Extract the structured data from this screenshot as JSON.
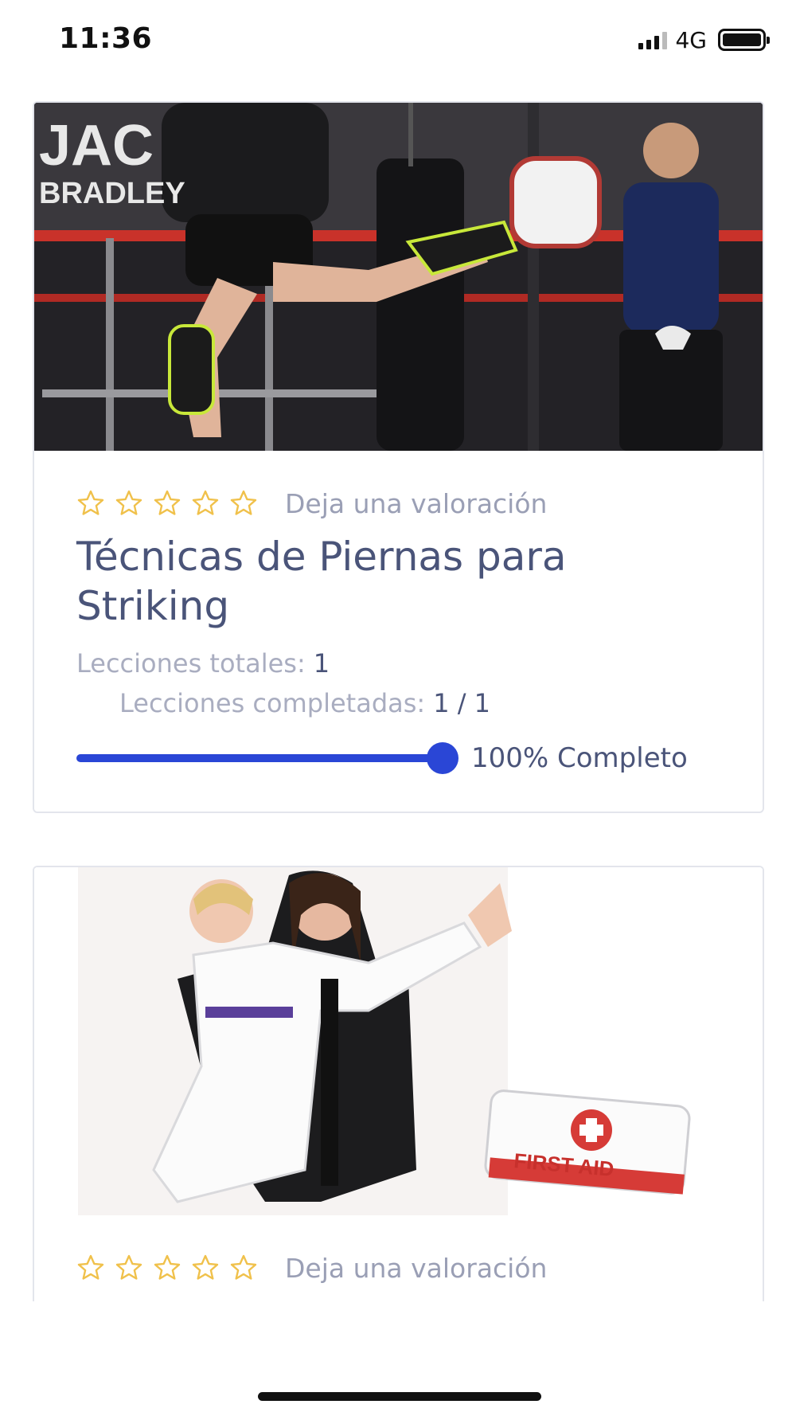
{
  "status_bar": {
    "time": "11:36",
    "network": "4G",
    "signal_bars": 3,
    "battery_level": 1.0
  },
  "colors": {
    "accent": "#2a46d6",
    "star": "#f0c14b",
    "title": "#4a5479",
    "muted": "#a9adc0"
  },
  "courses": [
    {
      "image_icon": "gym-training-photo",
      "rating_stars": 0,
      "rating_prompt": "Deja una valoración",
      "title": "Técnicas de Piernas para Striking",
      "total_lessons_label": "Lecciones totales:",
      "total_lessons_value": "1",
      "completed_lessons_label": "Lecciones completadas:",
      "completed_lessons_value": "1 / 1",
      "progress_fraction": 1.0,
      "progress_label": "100% Completo"
    },
    {
      "image_icon": "karate-first-aid-photo",
      "rating_stars": 0,
      "rating_prompt": "Deja una valoración"
    }
  ]
}
